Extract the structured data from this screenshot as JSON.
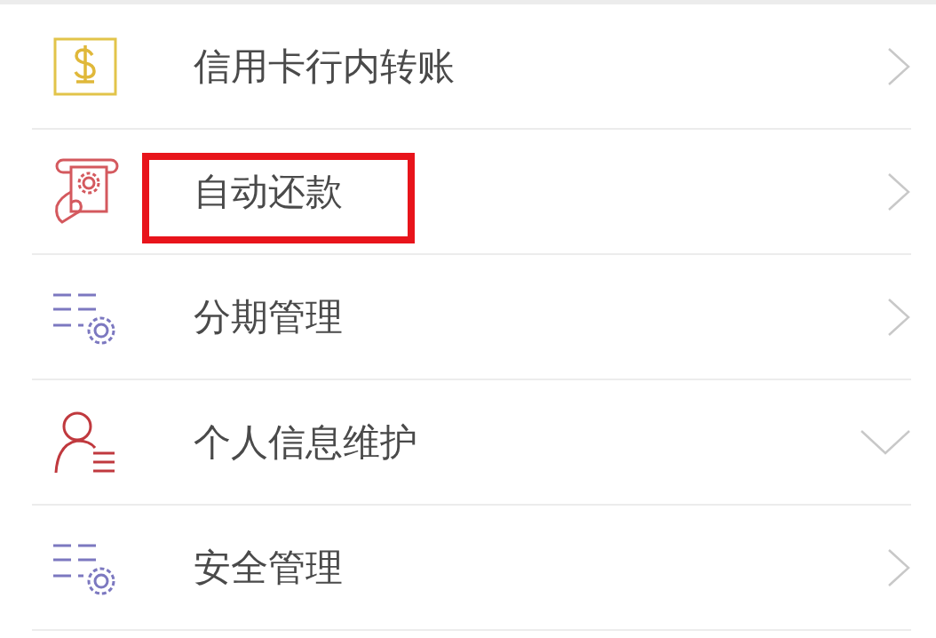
{
  "menu": [
    {
      "kind": "dollar",
      "label": "信用卡行内转账",
      "expanded": false,
      "highlighted": false
    },
    {
      "kind": "payment",
      "label": "自动还款",
      "expanded": false,
      "highlighted": true
    },
    {
      "kind": "list-gear",
      "label": "分期管理",
      "expanded": false,
      "highlighted": false
    },
    {
      "kind": "person",
      "label": "个人信息维护",
      "expanded": true,
      "highlighted": false
    },
    {
      "kind": "list-gear",
      "label": "安全管理",
      "expanded": false,
      "highlighted": false
    }
  ]
}
